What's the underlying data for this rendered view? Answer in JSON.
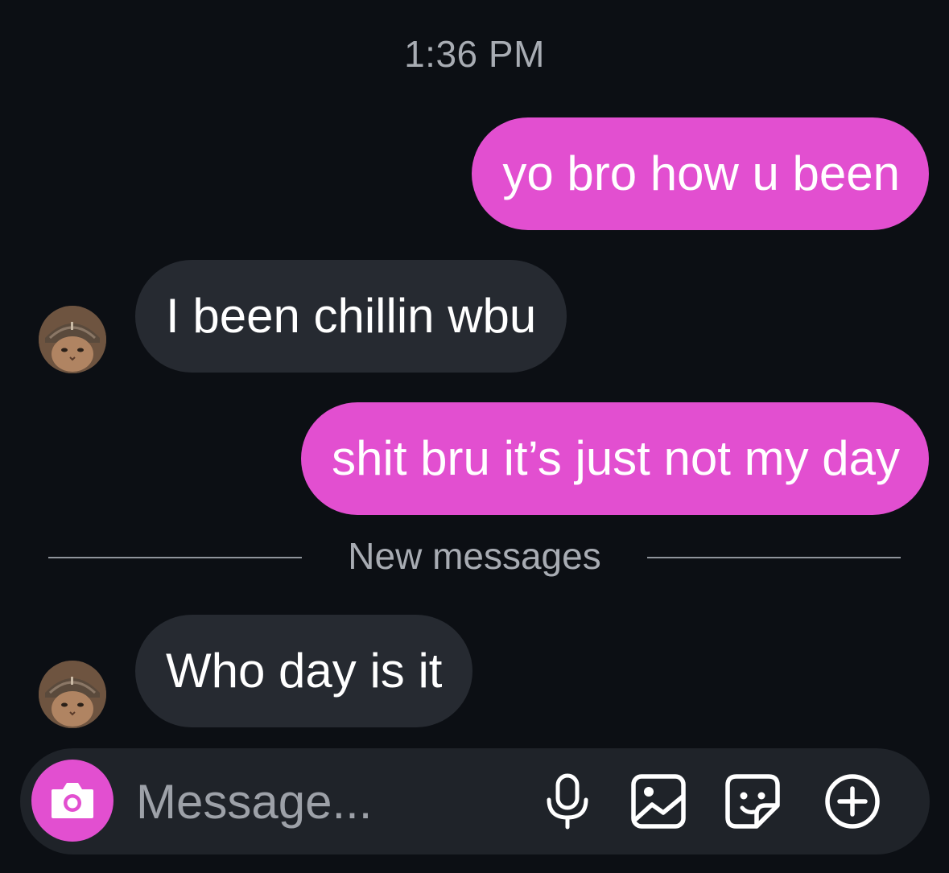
{
  "thread": {
    "timestamp": "1:36 PM",
    "divider_label": "New messages",
    "messages": [
      {
        "direction": "outgoing",
        "text": "yo bro how u been"
      },
      {
        "direction": "incoming",
        "text": "I been chillin wbu"
      },
      {
        "direction": "outgoing",
        "text": "shit bru it’s just not my day"
      },
      {
        "direction": "incoming",
        "text": "Who day is it"
      }
    ]
  },
  "composer": {
    "placeholder": "Message...",
    "icons": [
      "camera-icon",
      "microphone-icon",
      "gallery-icon",
      "sticker-icon",
      "plus-icon"
    ]
  },
  "colors": {
    "background": "#0c0f14",
    "outgoing_bubble": "#e24fd0",
    "incoming_bubble": "#262a31",
    "composer_background": "#1f2329",
    "muted_text": "#a8acb3"
  }
}
